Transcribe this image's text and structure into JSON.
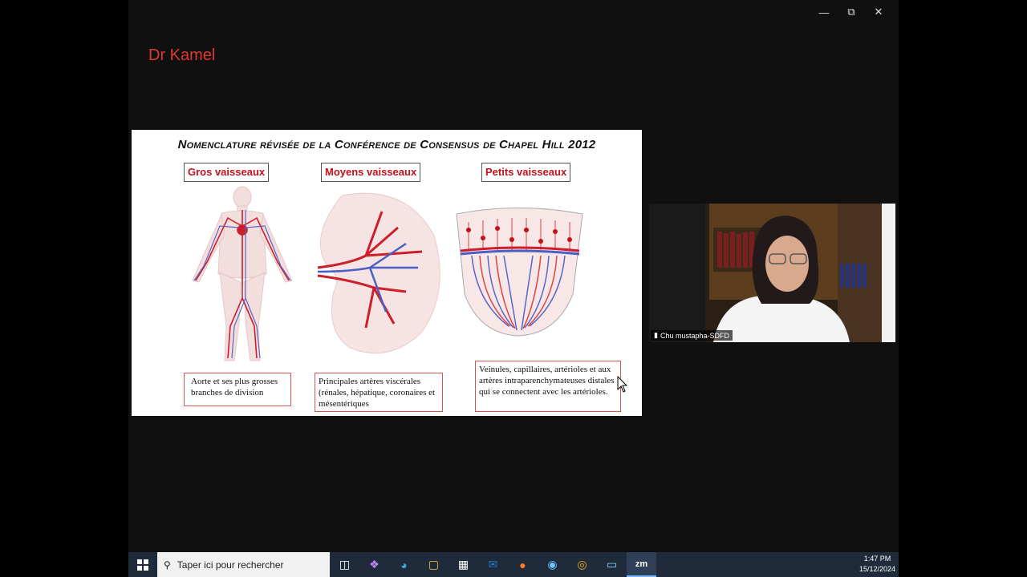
{
  "window": {
    "minimize_icon": "minimize-icon",
    "restore_icon": "restore-icon",
    "close_icon": "close-icon"
  },
  "presenter_name": "Dr Kamel",
  "slide": {
    "title": "Nomenclature révisée de la Conférence de Consensus de Chapel Hill 2012",
    "categories": [
      {
        "label": "Gros vaisseaux",
        "description": "Aorte et ses plus grosses branches de division"
      },
      {
        "label": "Moyens vaisseaux",
        "description": "Principales artères viscérales (rénales, hépatique, coronaires et mésentériques"
      },
      {
        "label": "Petits vaisseaux",
        "description": "Veinules, capillaires, artérioles et aux artères intraparenchymateuses distales qui se connectent avec les artérioles."
      }
    ]
  },
  "participant": {
    "name": "Chu mustapha-SDFD"
  },
  "taskbar": {
    "search_placeholder": "Taper ici pour rechercher",
    "time": "1:47 PM",
    "date": "15/12/2024"
  },
  "colors": {
    "presenter": "#e0392b",
    "accent_red": "#c0121d",
    "taskbar": "#1f2b3a"
  }
}
